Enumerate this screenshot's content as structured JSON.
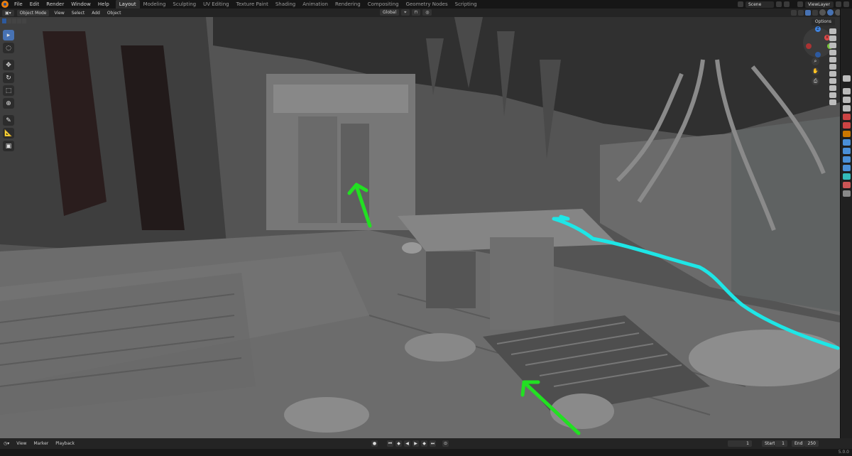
{
  "topbar": {
    "menu": [
      "File",
      "Edit",
      "Render",
      "Window",
      "Help"
    ],
    "workspaces": [
      "Layout",
      "Modeling",
      "Sculpting",
      "UV Editing",
      "Texture Paint",
      "Shading",
      "Animation",
      "Rendering",
      "Compositing",
      "Geometry Nodes",
      "Scripting"
    ],
    "active_workspace": "Layout",
    "scene": "Scene",
    "view_layer": "ViewLayer"
  },
  "viewport_header": {
    "mode": "Object Mode",
    "menu": [
      "View",
      "Select",
      "Add",
      "Object"
    ],
    "orientation": "Global",
    "options": "Options"
  },
  "tools": [
    "select-box",
    "cursor",
    "move",
    "rotate",
    "scale",
    "transform",
    "annotate",
    "measure",
    "add-cube"
  ],
  "gizmo": {
    "x": "X",
    "y": "Y",
    "z": "Z"
  },
  "timeline": {
    "menu": [
      "View",
      "Marker",
      "Playback"
    ],
    "current_frame": "1",
    "start_label": "Start",
    "start": "1",
    "end_label": "End",
    "end": "250"
  },
  "status": {
    "version": "5.0.0"
  },
  "colors": {
    "accent": "#4772b3",
    "annotation_green": "#22e022",
    "annotation_cyan": "#1ee6e6"
  }
}
